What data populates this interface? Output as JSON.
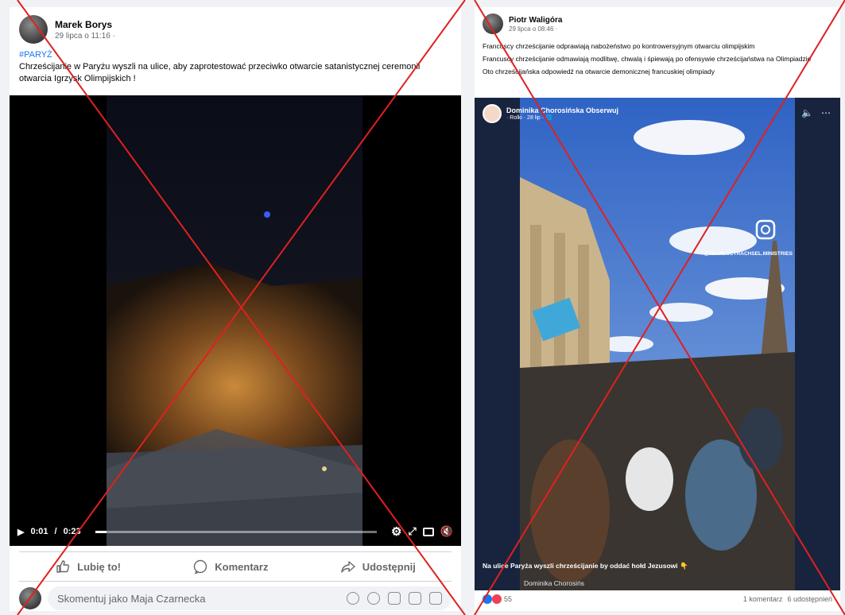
{
  "left_post": {
    "author": "Marek Borys",
    "time": "29 lipca o 11:16 ·",
    "hashtag": "#PARYŻ",
    "text": "Chrześcijanie w Paryżu wyszli na ulice, aby zaprotestować przeciwko otwarcie satanistycznej ceremonii otwarcia Igrzysk Olimpijskich !",
    "video": {
      "current_time": "0:01",
      "separator": "/",
      "duration": "0:23",
      "progress": 0.04
    },
    "actions": {
      "like": "Lubię to!",
      "comment": "Komentarz",
      "share": "Udostępnij"
    },
    "comment_placeholder": "Skomentuj jako Maja Czarnecka"
  },
  "right_post": {
    "author": "Piotr Waligóra",
    "time": "29 lipca o 08:46 ·",
    "lines": [
      "Francuscy chrześcijanie odprawiają nabożeństwo po kontrowersyjnym otwarciu olimpijskim",
      "Francuscy chrześcijanie odmawiają modlitwę, chwalą i śpiewają po ofensywie chrześcijaństwa na Olimpiadzie",
      "Oto chrześcijańska odpowiedź na otwarcie demonicznej francuskiej olimpiady"
    ],
    "reel": {
      "author": "Dominika Chorosińska Obserwuj",
      "meta": "· Rolki · 28 lip · ",
      "watermark": "@JEANLUCTRACHSEL.MINISTRIES",
      "caption": "Na ulice Paryża wyszli chrześcijanie by oddać hołd Jezusowi 👇",
      "sub_label": "Dominika Chorosińs"
    },
    "footer": {
      "reactions": "55",
      "comments": "1 komentarz",
      "shares": "6 udostępnień"
    }
  },
  "colors": {
    "accent": "#1877f2",
    "cross": "#e02020"
  }
}
